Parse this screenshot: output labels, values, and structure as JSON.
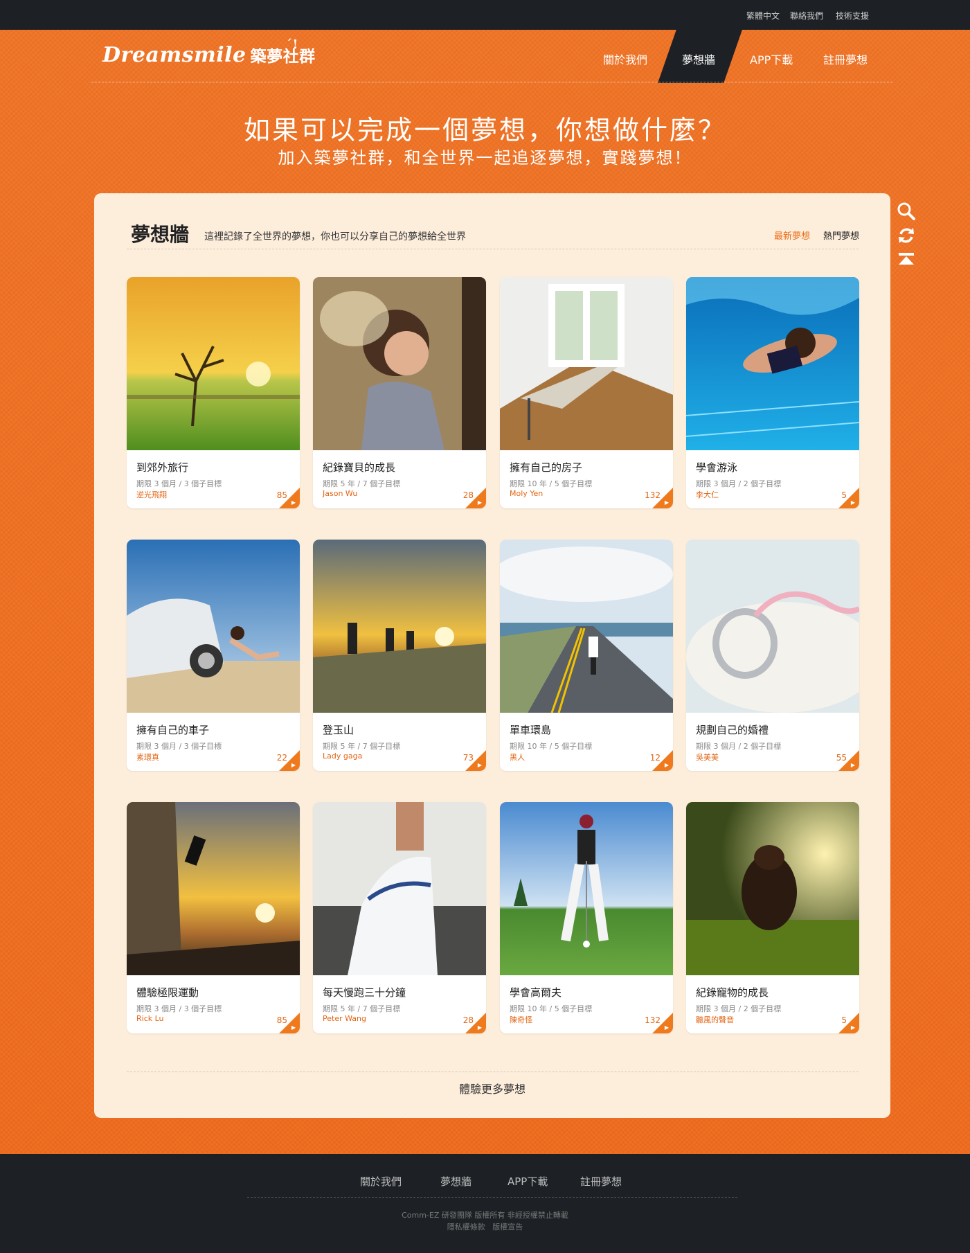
{
  "topbar": {
    "links": [
      "繁體中文",
      "聯絡我們",
      "技術支援"
    ]
  },
  "header": {
    "logo_text": "Dreamsmile",
    "logo_cn": "築夢社群",
    "nav": [
      "關於我們",
      "夢想牆",
      "APP下載",
      "註冊夢想"
    ],
    "active_nav": "夢想牆"
  },
  "hero": {
    "title": "如果可以完成一個夢想，你想做什麼？",
    "subtitle": "加入築夢社群，和全世界一起追逐夢想，實踐夢想！"
  },
  "side_tools": [
    "search-icon",
    "refresh-icon",
    "back-to-top-icon"
  ],
  "wall": {
    "title": "夢想牆",
    "description": "這裡記錄了全世界的夢想，你也可以分享自己的夢想給全世界",
    "tabs": [
      "最新夢想",
      "熱門夢想"
    ],
    "active_tab": "最新夢想",
    "cards": [
      {
        "title": "到郊外旅行",
        "meta": "期限 3 個月 / 3 個子目標",
        "author": "逆光飛翔",
        "count": "85",
        "scene": "tree-sunset"
      },
      {
        "title": "紀錄寶貝的成長",
        "meta": "期限 5 年 / 7 個子目標",
        "author": "Jason Wu",
        "count": "28",
        "scene": "child"
      },
      {
        "title": "擁有自己的房子",
        "meta": "期限 10 年 / 5 個子目標",
        "author": "Moly Yen",
        "count": "132",
        "scene": "room"
      },
      {
        "title": "學會游泳",
        "meta": "期限 3 個月 / 2 個子目標",
        "author": "李大仁",
        "count": "5",
        "scene": "swim"
      },
      {
        "title": "擁有自己的車子",
        "meta": "期限 3 個月 / 3 個子目標",
        "author": "素環真",
        "count": "22",
        "scene": "car"
      },
      {
        "title": "登玉山",
        "meta": "期限 5 年 / 7 個子目標",
        "author": "Lady gaga",
        "count": "73",
        "scene": "hikers"
      },
      {
        "title": "單車環島",
        "meta": "期限 10 年 / 5 個子目標",
        "author": "黑人",
        "count": "12",
        "scene": "cyclist"
      },
      {
        "title": "規劃自己的婚禮",
        "meta": "期限 3 個月 / 2 個子目標",
        "author": "吳美美",
        "count": "55",
        "scene": "ring"
      },
      {
        "title": "體驗極限運動",
        "meta": "期限 3 個月 / 3 個子目標",
        "author": "Rick Lu",
        "count": "85",
        "scene": "climber"
      },
      {
        "title": "每天慢跑三十分鐘",
        "meta": "期限 5 年 / 7 個子目標",
        "author": "Peter Wang",
        "count": "28",
        "scene": "shoe"
      },
      {
        "title": "學會高爾夫",
        "meta": "期限 10 年 / 5 個子目標",
        "author": "陳奇怪",
        "count": "132",
        "scene": "golf"
      },
      {
        "title": "紀錄寵物的成長",
        "meta": "期限 3 個月 / 2 個子目標",
        "author": "聽風的聲音",
        "count": "5",
        "scene": "dog"
      }
    ],
    "more_label": "體驗更多夢想"
  },
  "footer": {
    "nav": [
      "關於我們",
      "夢想牆",
      "APP下載",
      "註冊夢想"
    ],
    "copyright": "Comm-EZ 研發團隊 版權所有 非經授權禁止轉載",
    "legal": [
      "隱私權條款",
      "版權宣告"
    ]
  },
  "colors": {
    "brand_orange": "#f06f1f",
    "dark": "#1d2125",
    "panel": "#fdeedc",
    "accent_text": "#e26513"
  }
}
